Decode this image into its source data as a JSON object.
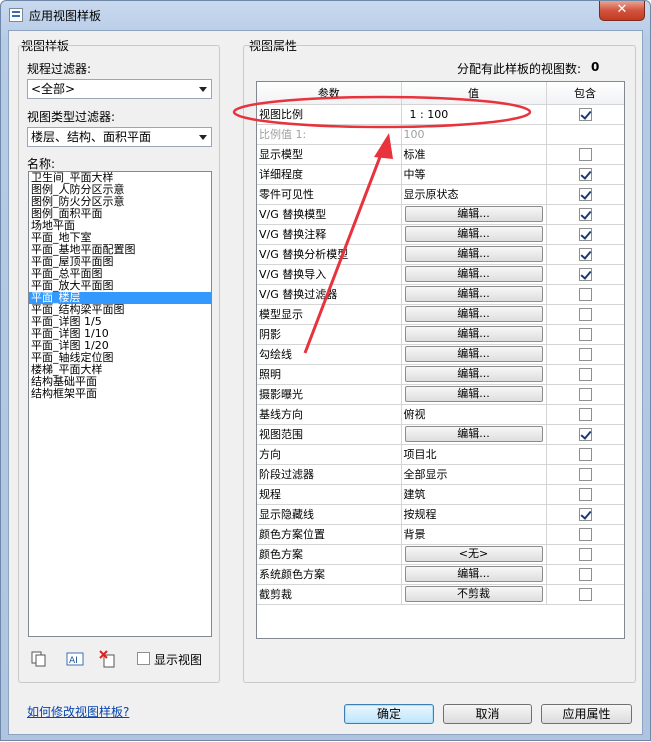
{
  "window": {
    "title": "应用视图样板",
    "close_glyph": "✕"
  },
  "left": {
    "group_title": "视图样板",
    "discipline_label": "规程过滤器:",
    "discipline_value": "<全部>",
    "viewtype_label": "视图类型过滤器:",
    "viewtype_value": "楼层、结构、面积平面",
    "names_label": "名称:",
    "names": [
      "卫生间_平面大样",
      "图例_人防分区示意",
      "图例_防火分区示意",
      "图例_面积平面",
      "场地平面",
      "平面_地下室",
      "平面_基地平面配置图",
      "平面_屋顶平面图",
      "平面_总平面图",
      "平面_放大平面图",
      "平面_楼层",
      "平面_结构梁平面图",
      "平面_详图 1/5",
      "平面_详图 1/10",
      "平面_详图 1/20",
      "平面_轴线定位图",
      "楼梯_平面大样",
      "结构基础平面",
      "结构框架平面"
    ],
    "selected_index": 10,
    "show_views_label": "显示视图"
  },
  "right": {
    "group_title": "视图属性",
    "assigned_label": "分配有此样板的视图数:",
    "assigned_count": "0",
    "headers": {
      "param": "参数",
      "value": "值",
      "include": "包含"
    },
    "rows": [
      {
        "param": "视图比例",
        "value": "1 : 100",
        "type": "text",
        "include": true
      },
      {
        "param": "比例值 1:",
        "value": "100",
        "type": "text",
        "include": null,
        "disabled": true
      },
      {
        "param": "显示模型",
        "value": "标准",
        "type": "text",
        "include": false
      },
      {
        "param": "详细程度",
        "value": "中等",
        "type": "text",
        "include": true
      },
      {
        "param": "零件可见性",
        "value": "显示原状态",
        "type": "text",
        "include": true
      },
      {
        "param": "V/G 替换模型",
        "value": "编辑...",
        "type": "button",
        "include": true
      },
      {
        "param": "V/G 替换注释",
        "value": "编辑...",
        "type": "button",
        "include": true
      },
      {
        "param": "V/G 替换分析模型",
        "value": "编辑...",
        "type": "button",
        "include": true
      },
      {
        "param": "V/G 替换导入",
        "value": "编辑...",
        "type": "button",
        "include": true
      },
      {
        "param": "V/G 替换过滤器",
        "value": "编辑...",
        "type": "button",
        "include": false
      },
      {
        "param": "模型显示",
        "value": "编辑...",
        "type": "button",
        "include": false
      },
      {
        "param": "阴影",
        "value": "编辑...",
        "type": "button",
        "include": false
      },
      {
        "param": "勾绘线",
        "value": "编辑...",
        "type": "button",
        "include": false
      },
      {
        "param": "照明",
        "value": "编辑...",
        "type": "button",
        "include": false
      },
      {
        "param": "摄影曝光",
        "value": "编辑...",
        "type": "button",
        "include": false
      },
      {
        "param": "基线方向",
        "value": "俯视",
        "type": "text",
        "include": false
      },
      {
        "param": "视图范围",
        "value": "编辑...",
        "type": "button",
        "include": true
      },
      {
        "param": "方向",
        "value": "项目北",
        "type": "text",
        "include": false
      },
      {
        "param": "阶段过滤器",
        "value": "全部显示",
        "type": "text",
        "include": false
      },
      {
        "param": "规程",
        "value": "建筑",
        "type": "text",
        "include": false
      },
      {
        "param": "显示隐藏线",
        "value": "按规程",
        "type": "text",
        "include": true
      },
      {
        "param": "颜色方案位置",
        "value": "背景",
        "type": "text",
        "include": false
      },
      {
        "param": "颜色方案",
        "value": "<无>",
        "type": "button",
        "include": false
      },
      {
        "param": "系统颜色方案",
        "value": "编辑...",
        "type": "button",
        "include": false
      },
      {
        "param": "截剪裁",
        "value": "不剪裁",
        "type": "button",
        "include": false
      }
    ]
  },
  "footer": {
    "help_link": "如何修改视图样板?",
    "ok": "确定",
    "cancel": "取消",
    "apply": "应用属性"
  },
  "annotation_color": "#e8323c"
}
